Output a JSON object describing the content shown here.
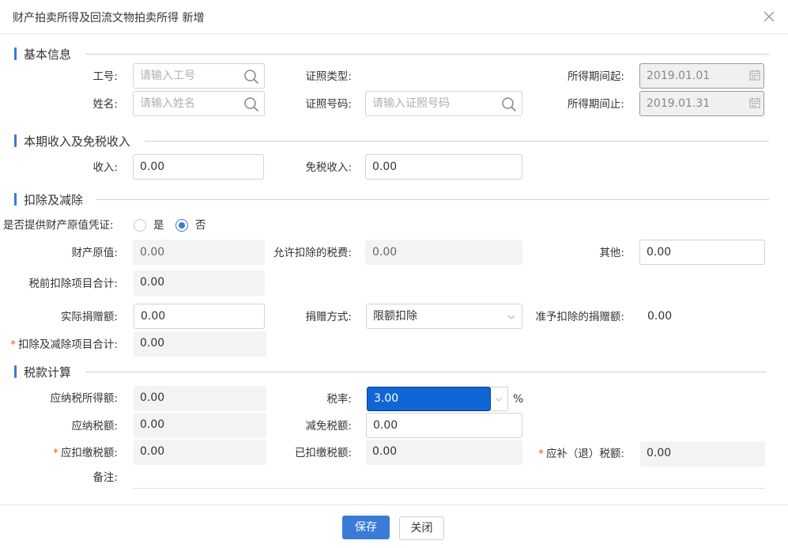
{
  "dialog": {
    "title": "财产拍卖所得及回流文物拍卖所得 新增"
  },
  "sections": {
    "basic": "基本信息",
    "income": "本期收入及免税收入",
    "deduction": "扣除及减除",
    "tax": "税款计算"
  },
  "basic": {
    "employee_id_label": "工号:",
    "employee_id_placeholder": "请输入工号",
    "name_label": "姓名:",
    "name_placeholder": "请输入姓名",
    "id_type_label": "证照类型:",
    "id_number_label": "证照号码:",
    "id_number_placeholder": "请输入证照号码",
    "period_start_label": "所得期间起:",
    "period_start_value": "2019.01.01",
    "period_end_label": "所得期间止:",
    "period_end_value": "2019.01.31"
  },
  "income": {
    "income_label": "收入:",
    "income_value": "0.00",
    "exempt_label": "免税收入:",
    "exempt_value": "0.00"
  },
  "deduction": {
    "proof_label": "是否提供财产原值凭证:",
    "proof_options": [
      "是",
      "否"
    ],
    "proof_selected": "否",
    "original_value_label": "财产原值:",
    "original_value": "0.00",
    "allowed_tax_label": "允许扣除的税费:",
    "allowed_tax_value": "0.00",
    "other_label": "其他:",
    "other_value": "0.00",
    "pretax_total_label": "税前扣除项目合计:",
    "pretax_total_value": "0.00",
    "donation_label": "实际捐赠额:",
    "donation_value": "0.00",
    "donation_method_label": "捐赠方式:",
    "donation_method_value": "限额扣除",
    "allowed_donation_label": "准予扣除的捐赠额:",
    "allowed_donation_value": "0.00",
    "total_label": "扣除及减除项目合计:",
    "total_value": "0.00"
  },
  "tax": {
    "taxable_income_label": "应纳税所得额:",
    "taxable_income_value": "0.00",
    "rate_label": "税率:",
    "rate_value": "3.00",
    "rate_unit": "%",
    "tax_payable_label": "应纳税额:",
    "tax_payable_value": "0.00",
    "tax_reduction_label": "减免税额:",
    "tax_reduction_value": "0.00",
    "withholding_label": "应扣缴税额:",
    "withholding_value": "0.00",
    "withheld_label": "已扣缴税额:",
    "withheld_value": "0.00",
    "refund_label": "应补（退）税额:",
    "refund_value": "0.00",
    "remark_label": "备注:"
  },
  "footer": {
    "save_label": "保存",
    "close_label": "关闭"
  },
  "colors": {
    "accent": "#3a7bd5",
    "required": "#e8542c",
    "highlight": "#1166d6"
  }
}
